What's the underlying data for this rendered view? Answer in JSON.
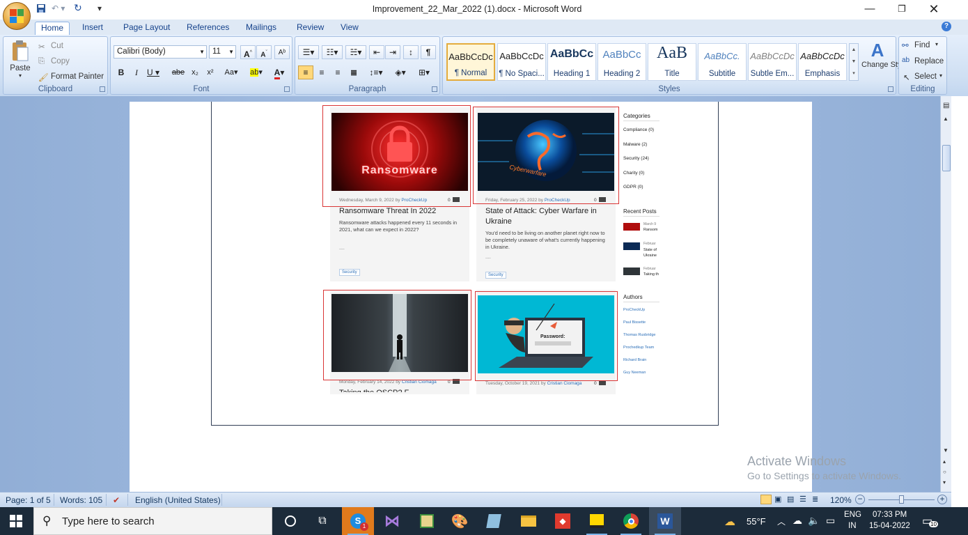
{
  "window": {
    "title": "Improvement_22_Mar_2022 (1).docx - Microsoft Word",
    "controls": [
      "minimize",
      "restore",
      "close"
    ]
  },
  "tabs": [
    "Home",
    "Insert",
    "Page Layout",
    "References",
    "Mailings",
    "Review",
    "View"
  ],
  "active_tab": "Home",
  "clipboard": {
    "paste": "Paste",
    "cut": "Cut",
    "copy": "Copy",
    "format_painter": "Format Painter",
    "label": "Clipboard"
  },
  "font": {
    "name": "Calibri (Body)",
    "size": "11",
    "label": "Font"
  },
  "paragraph": {
    "label": "Paragraph"
  },
  "styles": {
    "items": [
      {
        "sample": "AaBbCcDc",
        "name": "¶ Normal"
      },
      {
        "sample": "AaBbCcDc",
        "name": "¶ No Spaci..."
      },
      {
        "sample": "AaBbCc",
        "name": "Heading 1"
      },
      {
        "sample": "AaBbCc",
        "name": "Heading 2"
      },
      {
        "sample": "AaB",
        "name": "Title"
      },
      {
        "sample": "AaBbCc.",
        "name": "Subtitle"
      },
      {
        "sample": "AaBbCcDc",
        "name": "Subtle Em..."
      },
      {
        "sample": "AaBbCcDc",
        "name": "Emphasis"
      }
    ],
    "change_styles": "Change Styles",
    "label": "Styles"
  },
  "editing": {
    "find": "Find",
    "replace": "Replace",
    "select": "Select",
    "label": "Editing"
  },
  "document": {
    "cards": [
      {
        "meta_date": "Wednesday, March 9, 2022",
        "meta_by": "by",
        "meta_author": "ProCheckUp",
        "comments": "0",
        "title": "Ransomware Threat In 2022",
        "excerpt": "Ransomware attacks happened every 11 seconds in 2021, what can we expect in 2022?",
        "more": "....",
        "tag": "Security",
        "image_text": "Ransomware"
      },
      {
        "meta_date": "Friday, February 25, 2022",
        "meta_by": "by",
        "meta_author": "ProCheckUp",
        "comments": "0",
        "title": "State of Attack: Cyber Warfare in Ukraine",
        "excerpt": "You'd need to be living on another planet right now to be completely unaware of what's currently happening in Ukraine.",
        "more": "....",
        "tag": "Security",
        "image_text": "Cyberwarfare"
      },
      {
        "meta_date": "Monday, February 14, 2022",
        "meta_by": "by",
        "meta_author": "Cristian Ciomaga",
        "comments": "0",
        "title": "Taking the OSCP? F..."
      },
      {
        "meta_date": "Tuesday, October 19, 2021",
        "meta_by": "by",
        "meta_author": "Cristian Ciomaga",
        "comments": "0",
        "image_text": "Password:"
      }
    ],
    "sidebar": {
      "categories_heading": "Categories",
      "categories": [
        "Compliance (0)",
        "Malware (2)",
        "Security (24)",
        "Charity (0)",
        "GDPR (0)"
      ],
      "recent_heading": "Recent Posts",
      "recent": [
        {
          "date": "March 9",
          "title": "Ransom"
        },
        {
          "date": "Februar",
          "title": "State of Ukraine"
        },
        {
          "date": "Februar",
          "title": "Taking th"
        }
      ],
      "authors_heading": "Authors",
      "authors": [
        "ProCheckUp",
        "Paul Bissette",
        "Thomas Rusbridge",
        "Prochedkup Team",
        "Richard Brain",
        "Guy Neeman"
      ]
    }
  },
  "watermark": {
    "line1": "Activate Windows",
    "line2": "Go to Settings to activate Windows."
  },
  "status": {
    "page": "Page: 1 of 5",
    "words": "Words: 105",
    "language": "English (United States)",
    "zoom": "120%"
  },
  "taskbar": {
    "search_placeholder": "Type here to search",
    "skype_badge": "1",
    "weather": "55°F",
    "lang1": "ENG",
    "lang2": "IN",
    "time": "07:33 PM",
    "date": "15-04-2022",
    "notifications": "10"
  }
}
